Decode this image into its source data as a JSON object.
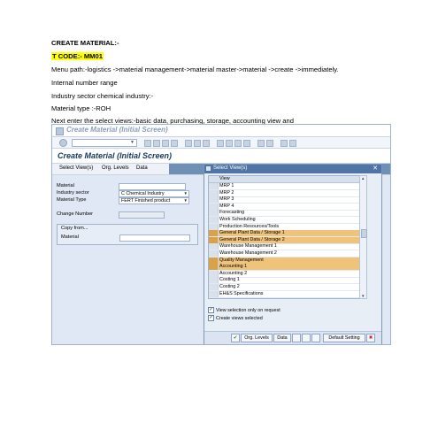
{
  "doc": {
    "heading": "CREATE MATERIAL:-",
    "tcode": "T CODE:- MM01",
    "menu_path": "Menu path:-logistics ->material management->material master->material ->create ->immediately.",
    "internal": "Internal number range",
    "industry": "Industry sector chemical industry:-",
    "material_type": "Material type :-ROH",
    "next": "Next enter the select views:-basic data, purchasing, storage, accounting view and"
  },
  "sap": {
    "window_title": "Create Material (Initial Screen)",
    "header_title": "Create Material (Initial Screen)",
    "appbar": [
      "Select View(s)",
      "Org. Levels",
      "Data"
    ],
    "fields": {
      "material_label": "Material",
      "industry_label": "Industry sector",
      "industry_value": "C Chemical Industry",
      "mattype_label": "Material Type",
      "mattype_value": "FERT Finished product",
      "change_label": "Change Number",
      "copy_from": "Copy from...",
      "copy_material_label": "Material"
    },
    "popup": {
      "title": "Select View(s)",
      "column": "View",
      "rows": [
        {
          "label": "MRP 1",
          "selected": false
        },
        {
          "label": "MRP 2",
          "selected": false
        },
        {
          "label": "MRP 3",
          "selected": false
        },
        {
          "label": "MRP 4",
          "selected": false
        },
        {
          "label": "Forecasting",
          "selected": false
        },
        {
          "label": "Work Scheduling",
          "selected": false
        },
        {
          "label": "Production Resources/Tools",
          "selected": false
        },
        {
          "label": "General Plant Data / Storage 1",
          "selected": true
        },
        {
          "label": "General Plant Data / Storage 2",
          "selected": true
        },
        {
          "label": "Warehouse Management 1",
          "selected": false
        },
        {
          "label": "Warehouse Management 2",
          "selected": false
        },
        {
          "label": "Quality Management",
          "selected": true
        },
        {
          "label": "Accounting 1",
          "selected": true
        },
        {
          "label": "Accounting 2",
          "selected": false
        },
        {
          "label": "Costing 1",
          "selected": false
        },
        {
          "label": "Costing 2",
          "selected": false
        },
        {
          "label": "EH&S Specifications",
          "selected": false
        }
      ],
      "check_view_only": "View selection only on request",
      "check_create": "Create views selected",
      "btn_org": "Org. Levels",
      "btn_data": "Data",
      "btn_default": "Default Setting"
    },
    "colors": {
      "highlight": "#f0c37a",
      "popup_title": "#4f74a5",
      "header_text": "#1b3a62"
    }
  }
}
